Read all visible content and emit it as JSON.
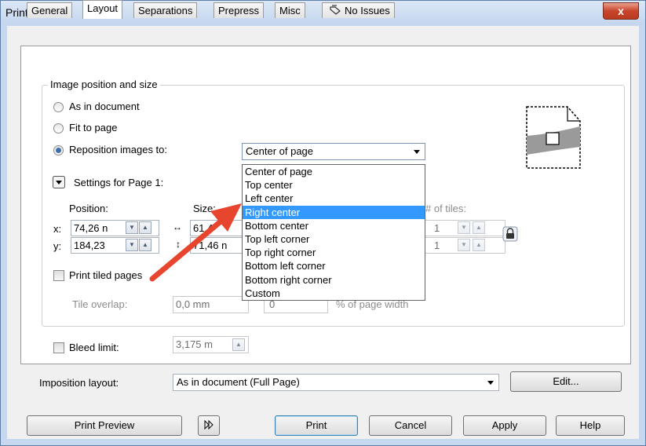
{
  "window": {
    "title": "Print",
    "close_glyph": "x"
  },
  "tabs": [
    {
      "label": "General"
    },
    {
      "label": "Layout",
      "active": true
    },
    {
      "label": "Separations"
    },
    {
      "label": "Prepress"
    },
    {
      "label": "Misc"
    },
    {
      "label": "No Issues",
      "icon": "checklist-icon"
    }
  ],
  "image_position": {
    "group_label": "Image position and size",
    "options": [
      {
        "label": "As in document",
        "selected": false
      },
      {
        "label": "Fit to page",
        "selected": false
      },
      {
        "label": "Reposition images to:",
        "selected": true
      }
    ],
    "reposition_value": "Center of page",
    "dropdown_options": [
      "Center of page",
      "Top center",
      "Left center",
      "Right center",
      "Bottom center",
      "Top left corner",
      "Top right corner",
      "Bottom left corner",
      "Bottom right corner",
      "Custom"
    ],
    "highlighted_option": "Right center"
  },
  "settings": {
    "label": "Settings for Page 1:",
    "position_label": "Position:",
    "size_label": "Size:",
    "tiles_label": "# of tiles:",
    "x_label": "x:",
    "y_label": "y:",
    "x_value": "74,26 n",
    "y_value": "184,23",
    "width_value": "61,4",
    "height_value": "71,46 n",
    "tiles_x": "1",
    "tiles_y": "1"
  },
  "tiles": {
    "print_tiled_label": "Print tiled pages",
    "overlap_label": "Tile overlap:",
    "overlap_value": "0,0 mm",
    "overlap_percent": "0",
    "percent_label": "% of page width"
  },
  "bleed": {
    "label": "Bleed limit:",
    "value": "3,175 m"
  },
  "imposition": {
    "label": "Imposition layout:",
    "value": "As in document (Full Page)",
    "edit_label": "Edit..."
  },
  "footer": {
    "preview_label": "Print Preview",
    "print_label": "Print",
    "cancel_label": "Cancel",
    "apply_label": "Apply",
    "help_label": "Help"
  },
  "colors": {
    "highlight": "#3399ff",
    "annotation_arrow": "#e8452e"
  }
}
